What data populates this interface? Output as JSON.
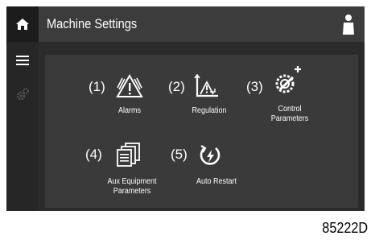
{
  "header": {
    "title": "Machine Settings"
  },
  "tiles": [
    {
      "number": "(1)",
      "label": "Alarms",
      "icon": "alarm-warning-icon"
    },
    {
      "number": "(2)",
      "label": "Regulation",
      "icon": "regulation-chart-icon"
    },
    {
      "number": "(3)",
      "label": "Control\nParameters",
      "icon": "control-gear-plus-icon"
    },
    {
      "number": "(4)",
      "label": "Aux Equipment\nParameters",
      "icon": "aux-equipment-list-icon"
    },
    {
      "number": "(5)",
      "label": "Auto Restart",
      "icon": "auto-restart-power-icon"
    }
  ],
  "figure_reference": "85222D",
  "colors": {
    "background": "#2b2b2b",
    "header": "#3c3c3c",
    "panel": "#3a3a3a",
    "text": "#ffffff"
  }
}
